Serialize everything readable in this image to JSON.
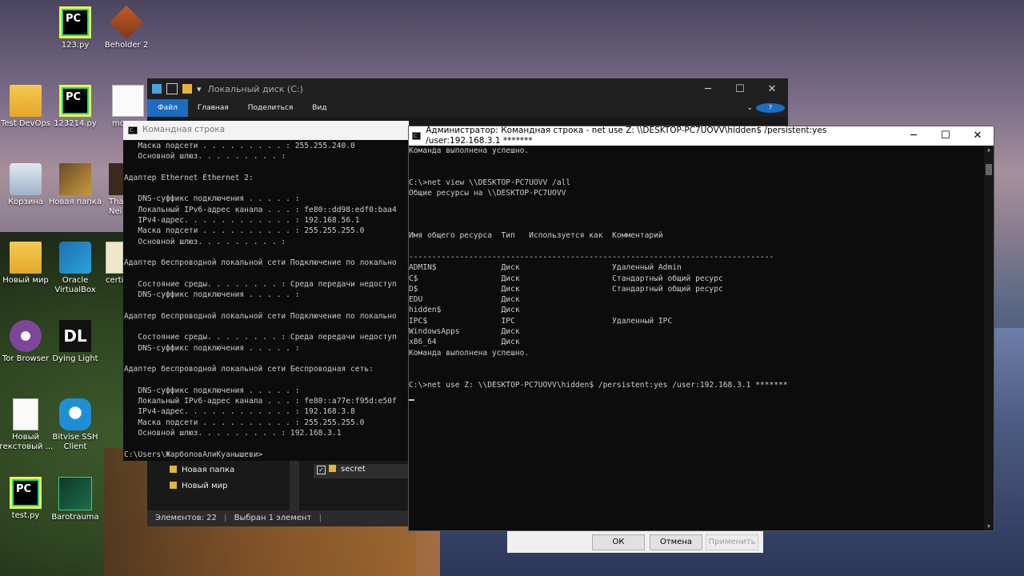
{
  "desktop": {
    "icons": [
      {
        "label": "123.py",
        "icon": "pycharm-icon"
      },
      {
        "label": "Beholder 2",
        "icon": "beholder-icon"
      },
      {
        "label": "Test DevOps",
        "icon": "folder-icon"
      },
      {
        "label": "123214.py",
        "icon": "pycharm-icon"
      },
      {
        "label": "mo",
        "icon": "document-icon"
      },
      {
        "label": "Корзина",
        "icon": "recycle-bin-icon"
      },
      {
        "label": "Новая папка",
        "icon": "folder-icon"
      },
      {
        "label": "That's Nei",
        "icon": "game-icon"
      },
      {
        "label": "Новый мир",
        "icon": "folder-icon"
      },
      {
        "label": "Oracle VirtualBox",
        "icon": "virtualbox-icon"
      },
      {
        "label": "certi",
        "icon": "certificate-icon"
      },
      {
        "label": "Tor Browser",
        "icon": "tor-icon"
      },
      {
        "label": "Dying Light",
        "icon": "dying-light-icon"
      },
      {
        "label": "Новый текстовый ...",
        "icon": "document-icon"
      },
      {
        "label": "Bitvise SSH Client",
        "icon": "bitvise-icon"
      },
      {
        "label": "test.py",
        "icon": "pycharm-icon"
      },
      {
        "label": "Barotrauma",
        "icon": "barotrauma-icon"
      }
    ]
  },
  "explorer": {
    "title": "Локальный диск (C:)",
    "ribbon": {
      "file": "Файл",
      "home": "Главная",
      "share": "Поделиться",
      "view": "Вид"
    },
    "tree": [
      "Новая папка",
      "Новый мир"
    ],
    "selected_item": "secret",
    "status": {
      "count": "Элементов: 22",
      "selected": "Выбран 1 элемент"
    }
  },
  "cmd_user": {
    "title": "Командная строка",
    "output": "   Маска подсети . . . . . . . . . : 255.255.240.0\n   Основной шлюз. . . . . . . . . :\n\nАдаптер Ethernet Ethernet 2:\n\n   DNS-суффикс подключения . . . . . :\n   Локальный IPv6-адрес канала . . . : fe80::dd98:edf0:baa4\n   IPv4-адрес. . . . . . . . . . . . : 192.168.56.1\n   Маска подсети . . . . . . . . . . : 255.255.255.0\n   Основной шлюз. . . . . . . . . :\n\nАдаптер беспроводной локальной сети Подключение по локально\n\n   Состояние среды. . . . . . . . : Среда передачи недоступ\n   DNS-суффикс подключения . . . . . :\n\nАдаптер беспроводной локальной сети Подключение по локально\n\n   Состояние среды. . . . . . . . : Среда передачи недоступ\n   DNS-суффикс подключения . . . . . :\n\nАдаптер беспроводной локальной сети Беспроводная сеть:\n\n   DNS-суффикс подключения . . . . . :\n   Локальный IPv6-адрес канала . . . : fe80::a77e:f95d:e50f\n   IPv4-адрес. . . . . . . . . . . . : 192.168.3.8\n   Маска подсети . . . . . . . . . . : 255.255.255.0\n   Основной шлюз. . . . . . . . . : 192.168.3.1\n\nC:\\Users\\ЖарболовАлиКуанышеви>"
  },
  "cmd_admin": {
    "title": "Администратор: Командная строка - net  use Z: \\\\DESKTOP-PC7UOVV\\hidden$ /persistent:yes /user:192.168.3.1 *******",
    "output": "Команда выполнена успешно.\n\n\nC:\\>net view \\\\DESKTOP-PC7UOVV /all\nОбщие ресурсы на \\\\DESKTOP-PC7UOVV\n\n\n\nИмя общего ресурса  Тип   Используется как  Комментарий\n\n-------------------------------------------------------------------------------\nADMIN$              Диск                    Удаленный Admin\nC$                  Диск                    Стандартный общий ресурс\nD$                  Диск                    Стандартный общий ресурс\nEDU                 Диск\nhidden$             Диск\nIPC$                IPC                     Удаленный IPC\nWindowsApps         Диск\nx86_64              Диск\nКоманда выполнена успешно.\n\n\nC:\\>net use Z: \\\\DESKTOP-PC7UOVV\\hidden$ /persistent:yes /user:192.168.3.1 *******\n"
  },
  "dialog": {
    "ok": "ОК",
    "cancel": "Отмена",
    "apply": "Применить"
  }
}
